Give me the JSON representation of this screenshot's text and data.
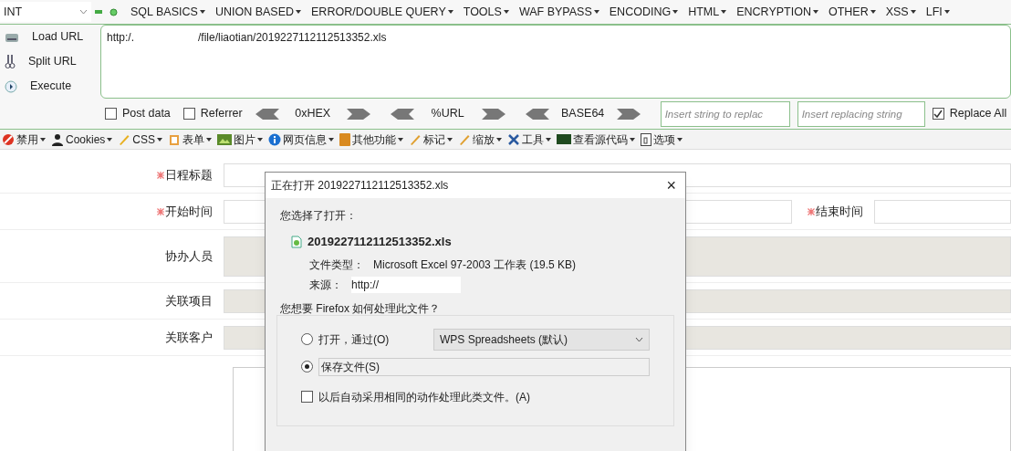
{
  "injector": {
    "mode_select": "INT",
    "menu": [
      "SQL BASICS",
      "UNION BASED",
      "ERROR/DOUBLE QUERY",
      "TOOLS",
      "WAF BYPASS",
      "ENCODING",
      "HTML",
      "ENCRYPTION",
      "OTHER",
      "XSS",
      "LFI"
    ],
    "actions": [
      "Load URL",
      "Split URL",
      "Execute"
    ],
    "url": "http:/.                     /file/liaotian/2019227112112513352.xls",
    "post_data": {
      "label": "Post data",
      "checked": false
    },
    "referrer": {
      "label": "Referrer",
      "checked": false
    },
    "encoders": [
      "0xHEX",
      "%URL",
      "BASE64"
    ],
    "replace_from": {
      "placeholder": "Insert string to replac"
    },
    "replace_to": {
      "placeholder": "Insert replacing string"
    },
    "replace_all": {
      "label": "Replace All",
      "checked": true
    }
  },
  "toolbar": [
    "禁用",
    "Cookies",
    "CSS",
    "表单",
    "图片",
    "网页信息",
    "其他功能",
    "标记",
    "缩放",
    "工具",
    "查看源代码",
    "选项"
  ],
  "form": {
    "rows": [
      {
        "fields": [
          {
            "label": "日程标题",
            "required": true,
            "disabled": false
          }
        ]
      },
      {
        "fields": [
          {
            "label": "开始时间",
            "required": true,
            "disabled": false
          },
          {
            "label": "结束时间",
            "required": true,
            "disabled": false
          }
        ]
      },
      {
        "fields": [
          {
            "label": "协办人员",
            "required": false,
            "disabled": true
          }
        ]
      },
      {
        "fields": [
          {
            "label": "关联项目",
            "required": false,
            "disabled": true
          }
        ]
      },
      {
        "fields": [
          {
            "label": "关联客户",
            "required": false,
            "disabled": true
          }
        ]
      }
    ]
  },
  "dialog": {
    "title": "正在打开 2019227112112513352.xls",
    "close": "×",
    "intro": "您选择了打开：",
    "file_name": "2019227112112513352.xls",
    "type_label": "文件类型：",
    "type_value": "Microsoft Excel 97-2003 工作表 (19.5 KB)",
    "source_label": "来源：",
    "source_value": "http://",
    "question": "您想要 Firefox 如何处理此文件？",
    "options": [
      {
        "label": "打开，通过(O)",
        "selected": false,
        "app": "WPS Spreadsheets (默认)"
      },
      {
        "label": "保存文件(S)",
        "selected": true
      }
    ],
    "remember": {
      "label": "以后自动采用相同的动作处理此类文件。(A)",
      "checked": false
    }
  }
}
